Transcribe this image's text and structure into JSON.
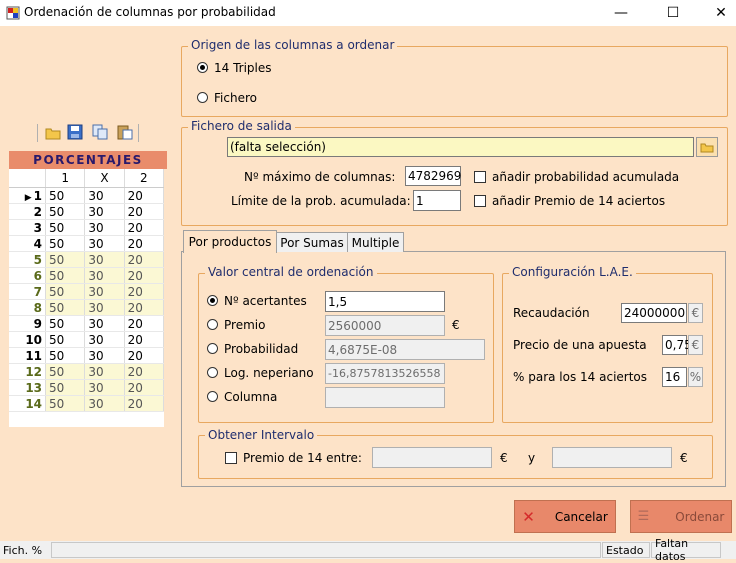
{
  "window": {
    "title": "Ordenación de columnas por probabilidad",
    "minimize": "—",
    "maximize": "☐",
    "close": "✕"
  },
  "origen": {
    "title": "Origen de las columnas a ordenar",
    "opt1": "14 Triples",
    "opt2": "Fichero"
  },
  "salida": {
    "title": "Fichero de salida",
    "file_value": "(falta selección)",
    "max_cols_label": "Nº máximo de columnas:",
    "max_cols_value": "4782969",
    "limite_label": "Límite de la prob. acumulada:",
    "limite_value": "1",
    "chk_prob": "añadir probabilidad acumulada",
    "chk_premio": "añadir Premio de 14 aciertos"
  },
  "porcentajes": {
    "header": "PORCENTAJES",
    "columns": [
      "1",
      "X",
      "2"
    ],
    "rows": [
      {
        "n": "1",
        "v": [
          "50",
          "30",
          "20"
        ],
        "current": true
      },
      {
        "n": "2",
        "v": [
          "50",
          "30",
          "20"
        ]
      },
      {
        "n": "3",
        "v": [
          "50",
          "30",
          "20"
        ]
      },
      {
        "n": "4",
        "v": [
          "50",
          "30",
          "20"
        ]
      },
      {
        "n": "5",
        "v": [
          "50",
          "30",
          "20"
        ]
      },
      {
        "n": "6",
        "v": [
          "50",
          "30",
          "20"
        ]
      },
      {
        "n": "7",
        "v": [
          "50",
          "30",
          "20"
        ]
      },
      {
        "n": "8",
        "v": [
          "50",
          "30",
          "20"
        ]
      },
      {
        "n": "9",
        "v": [
          "50",
          "30",
          "20"
        ]
      },
      {
        "n": "10",
        "v": [
          "50",
          "30",
          "20"
        ]
      },
      {
        "n": "11",
        "v": [
          "50",
          "30",
          "20"
        ]
      },
      {
        "n": "12",
        "v": [
          "50",
          "30",
          "20"
        ]
      },
      {
        "n": "13",
        "v": [
          "50",
          "30",
          "20"
        ]
      },
      {
        "n": "14",
        "v": [
          "50",
          "30",
          "20"
        ]
      }
    ],
    "current_marker": "▶"
  },
  "tabs": [
    "Por productos",
    "Por Sumas",
    "Multiple"
  ],
  "valor_central": {
    "title": "Valor central de ordenación",
    "acertantes_label": "Nº acertantes",
    "acertantes_value": "1,5",
    "premio_label": "Premio",
    "premio_value": "2560000",
    "premio_unit": "€",
    "prob_label": "Probabilidad",
    "prob_value": "4,6875E-08",
    "log_label": "Log. neperiano",
    "log_value": "-16,8757813526558",
    "columna_label": "Columna",
    "columna_value": ""
  },
  "config": {
    "title": "Configuración L.A.E.",
    "recaudacion_label": "Recaudación",
    "recaudacion_value": "24000000",
    "recaudacion_unit": "€",
    "precio_label": "Precio de una apuesta",
    "precio_value": "0,75",
    "precio_unit": "€",
    "pct_label": "% para los 14 aciertos",
    "pct_value": "16",
    "pct_unit": "%"
  },
  "intervalo": {
    "title": "Obtener Intervalo",
    "chk_label": "Premio de 14 entre:",
    "from": "",
    "unit1": "€",
    "and": "y",
    "to": "",
    "unit2": "€"
  },
  "buttons": {
    "cancel": "Cancelar",
    "ordenar": "Ordenar"
  },
  "status": {
    "left": "Fich. %",
    "estado": "Estado",
    "faltan": "Faltan datos"
  },
  "colors": {
    "bg": "#fde3c8",
    "accent": "#e8886a",
    "group_title": "#1f2d6d",
    "alt_row": "#fbf8d4"
  }
}
